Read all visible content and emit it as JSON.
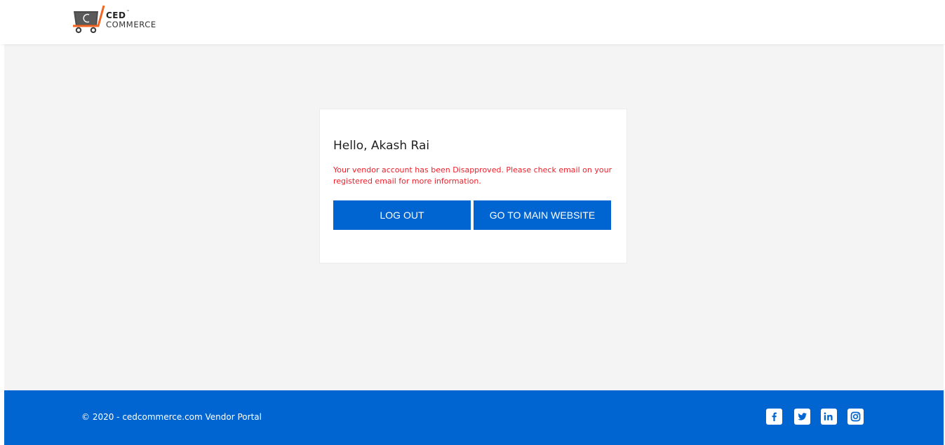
{
  "header": {
    "logo": {
      "brand_top": "CED",
      "brand_tm": "™",
      "brand_bottom": "COMMERCE"
    }
  },
  "card": {
    "greeting": "Hello, Akash Rai",
    "message": "Your vendor account has been Disapproved. Please check email on your registered email for more information.",
    "buttons": {
      "logout_label": "LOG OUT",
      "main_website_label": "GO TO MAIN WEBSITE"
    }
  },
  "footer": {
    "copyright": "© 2020 - cedcommerce.com Vendor Portal",
    "social": [
      "facebook-icon",
      "twitter-icon",
      "linkedin-icon",
      "instagram-icon"
    ]
  },
  "colors": {
    "primary_blue": "#0065d1",
    "error_red": "#ee1e2a",
    "page_bg": "#f4f4f4",
    "logo_orange": "#f26522"
  }
}
